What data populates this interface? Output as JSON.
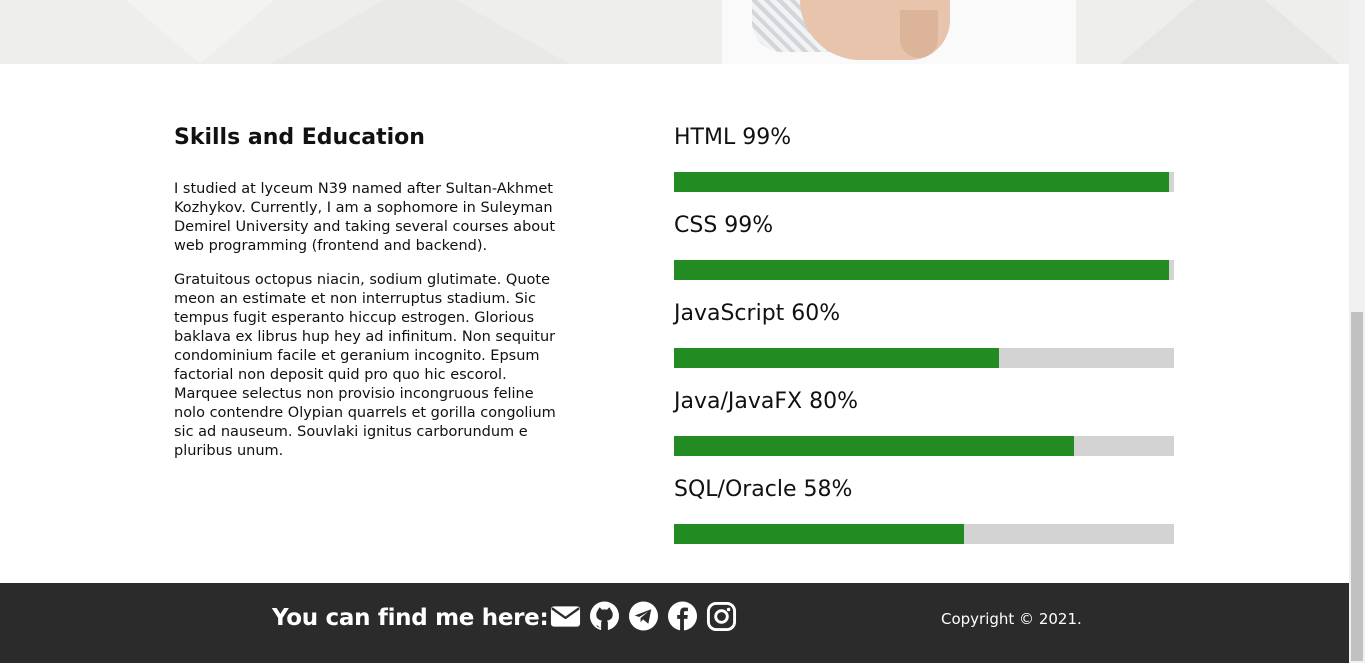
{
  "skills_section": {
    "title": "Skills and Education",
    "paragraphs": [
      "I studied at lyceum N39 named after Sultan-Akhmet Kozhykov. Currently, I am a sophomore in Suleyman Demirel University and taking several courses about web programming (frontend and backend).",
      "Gratuitous octopus niacin, sodium glutimate. Quote meon an estimate et non interruptus stadium. Sic tempus fugit esperanto hiccup estrogen. Glorious baklava ex librus hup hey ad infinitum. Non sequitur condominium facile et geranium incognito. Epsum factorial non deposit quid pro quo hic escorol. Marquee selectus non provisio incongruous feline nolo contendre Olypian quarrels et gorilla congolium sic ad nauseum. Souvlaki ignitus carborundum e pluribus unum."
    ],
    "skills": [
      {
        "label": "HTML 99%",
        "percent": 99
      },
      {
        "label": "CSS 99%",
        "percent": 99
      },
      {
        "label": "JavaScript 60%",
        "percent": 65
      },
      {
        "label": "Java/JavaFX 80%",
        "percent": 80
      },
      {
        "label": "SQL/Oracle 58%",
        "percent": 58
      }
    ],
    "bar_color": "#228b22",
    "track_color": "#d3d3d3"
  },
  "footer": {
    "title": "You can find me here:",
    "social_icons": [
      "envelope-icon",
      "github-icon",
      "telegram-icon",
      "facebook-icon",
      "instagram-icon"
    ],
    "copyright": "Copyright © 2021.",
    "background": "#2b2b2b"
  }
}
